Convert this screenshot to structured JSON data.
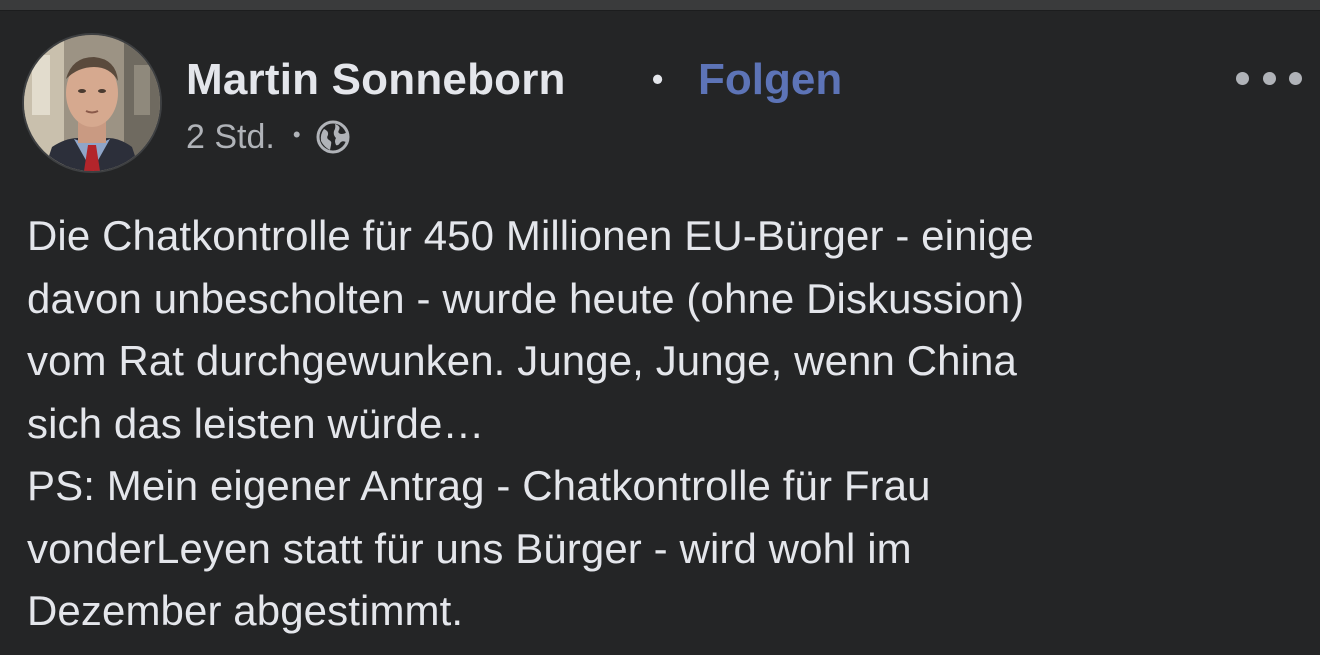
{
  "post": {
    "author": {
      "name": "Martin Sonneborn",
      "avatar_icon": "profile-photo"
    },
    "separator": "•",
    "follow_label": "Folgen",
    "time": "2 Std.",
    "meta_separator": "•",
    "audience_icon": "globe-icon",
    "more_icon": "more-options-icon",
    "text": "Die Chatkontrolle für 450 Millionen EU-Bürger - einige\ndavon unbescholten - wurde heute (ohne Diskussion)\nvom Rat durchgewunken. Junge, Junge, wenn China\nsich das leisten würde…\nPS: Mein eigener Antrag - Chatkontrolle für Frau\nvonderLeyen statt für uns Bürger - wird wohl im\nDezember abgestimmt."
  },
  "colors": {
    "background": "#242526",
    "primary_text": "#e4e6eb",
    "secondary_text": "#b0b3b8",
    "follow_link": "#5d74b7"
  }
}
